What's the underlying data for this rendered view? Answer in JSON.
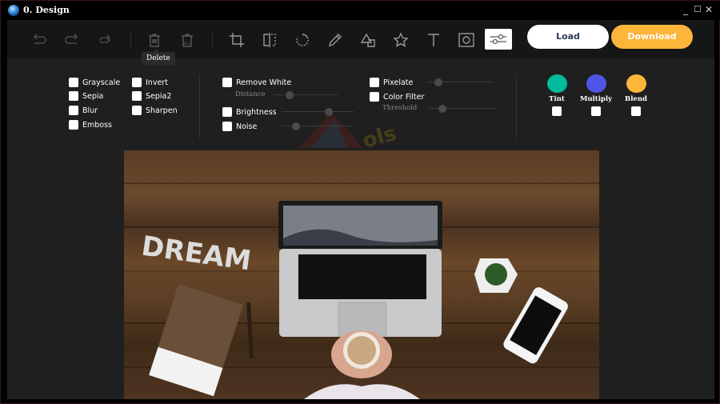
{
  "window": {
    "title": "0. Design",
    "controls": {
      "minimize": "_",
      "maximize": "☐",
      "close": "✕"
    }
  },
  "toolbar": {
    "history": [
      {
        "name": "undo-icon",
        "label": "Undo"
      },
      {
        "name": "redo-icon",
        "label": "Redo"
      },
      {
        "name": "reset-icon",
        "label": "Reset"
      }
    ],
    "delete": [
      {
        "name": "delete-icon",
        "label": "Delete"
      },
      {
        "name": "delete-all-icon",
        "label": "Delete All",
        "badge": "ALL"
      }
    ],
    "tools": [
      {
        "name": "crop-icon",
        "label": "Crop"
      },
      {
        "name": "flip-icon",
        "label": "Flip"
      },
      {
        "name": "rotate-icon",
        "label": "Rotate"
      },
      {
        "name": "draw-icon",
        "label": "Draw"
      },
      {
        "name": "shape-icon",
        "label": "Shape"
      },
      {
        "name": "icon-tool-icon",
        "label": "Icon"
      },
      {
        "name": "text-icon",
        "label": "Text"
      },
      {
        "name": "mask-icon",
        "label": "Mask"
      },
      {
        "name": "filter-icon",
        "label": "Filter",
        "active": true
      }
    ],
    "tooltip": "Delete",
    "load_label": "Load",
    "download_label": "Download"
  },
  "filters": {
    "basic": [
      {
        "label": "Grayscale",
        "checked": false
      },
      {
        "label": "Sepia",
        "checked": false
      },
      {
        "label": "Blur",
        "checked": false
      },
      {
        "label": "Emboss",
        "checked": false
      },
      {
        "label": "Invert",
        "checked": false
      },
      {
        "label": "Sepia2",
        "checked": false
      },
      {
        "label": "Sharpen",
        "checked": false
      }
    ],
    "remove_white": {
      "label": "Remove White",
      "checked": false,
      "sub_label": "Distance",
      "value": 0.25
    },
    "brightness": {
      "label": "Brightness",
      "checked": false,
      "value": 0.65
    },
    "noise": {
      "label": "Noise",
      "checked": false,
      "value": 0.2
    },
    "pixelate": {
      "label": "Pixelate",
      "checked": false,
      "value": 0.15
    },
    "color_filter": {
      "label": "Color Filter",
      "checked": false,
      "sub_label": "Threshold",
      "value": 0.2
    },
    "blend_modes": [
      {
        "label": "Tint",
        "color": "#00bb9a",
        "checked": false
      },
      {
        "label": "Multiply",
        "color": "#5055e6",
        "checked": false
      },
      {
        "label": "Blend",
        "color": "#fdb53a",
        "checked": false
      }
    ]
  },
  "canvas": {
    "image_description": "Top-down photo of wooden desk with laptop, DREAM letters, notebook, pen, coffee cup, succulent and smartphone",
    "dream_text": "DREAM"
  }
}
